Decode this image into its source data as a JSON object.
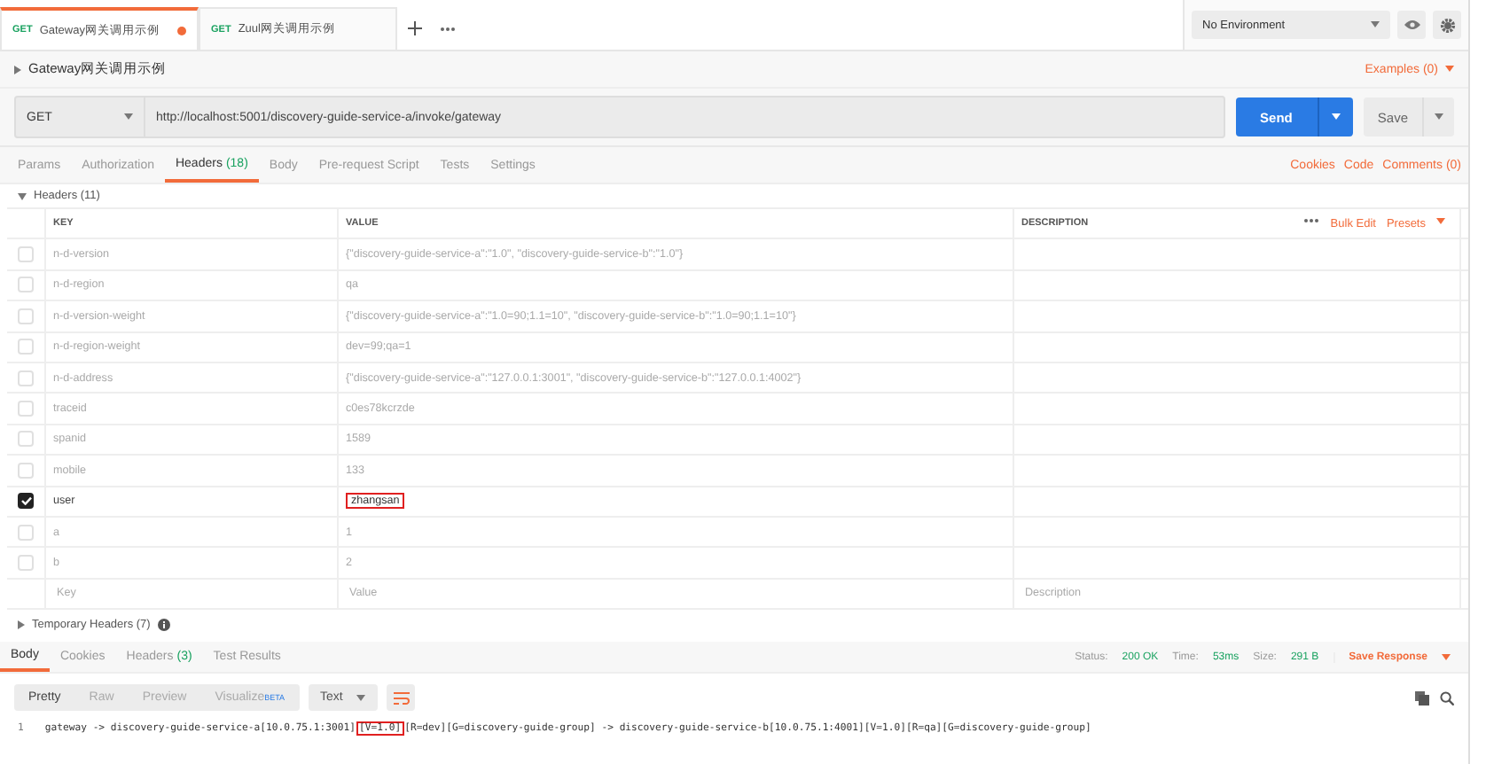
{
  "tabs": [
    {
      "method": "GET",
      "title": "Gateway网关调用示例",
      "selected": true,
      "unsaved": true
    },
    {
      "method": "GET",
      "title": "Zuul网关调用示例",
      "selected": false,
      "unsaved": false
    }
  ],
  "environment": {
    "value": "No Environment"
  },
  "request": {
    "name": "Gateway网关调用示例",
    "examples": "Examples (0)",
    "method": "GET",
    "url": "http://localhost:5001/discovery-guide-service-a/invoke/gateway",
    "send": "Send",
    "save": "Save"
  },
  "request_tabs": [
    {
      "label": "Params",
      "selected": false
    },
    {
      "label": "Authorization",
      "selected": false
    },
    {
      "label": "Headers",
      "count": "(18)",
      "selected": true
    },
    {
      "label": "Body",
      "selected": false
    },
    {
      "label": "Pre-request Script",
      "selected": false
    },
    {
      "label": "Tests",
      "selected": false
    },
    {
      "label": "Settings",
      "selected": false
    }
  ],
  "request_links": [
    "Cookies",
    "Code",
    "Comments (0)"
  ],
  "headers": {
    "title": "Headers (11)",
    "columns": [
      "KEY",
      "VALUE",
      "DESCRIPTION"
    ],
    "bulk_edit": "Bulk Edit",
    "presets": "Presets",
    "rows": [
      {
        "key": "n-d-version",
        "value": "{\"discovery-guide-service-a\":\"1.0\", \"discovery-guide-service-b\":\"1.0\"}",
        "checked": false,
        "highlighted": false
      },
      {
        "key": "n-d-region",
        "value": "qa",
        "checked": false,
        "highlighted": false
      },
      {
        "key": "n-d-version-weight",
        "value": "{\"discovery-guide-service-a\":\"1.0=90;1.1=10\", \"discovery-guide-service-b\":\"1.0=90;1.1=10\"}",
        "checked": false,
        "highlighted": false
      },
      {
        "key": "n-d-region-weight",
        "value": "dev=99;qa=1",
        "checked": false,
        "highlighted": false
      },
      {
        "key": "n-d-address",
        "value": "{\"discovery-guide-service-a\":\"127.0.0.1:3001\", \"discovery-guide-service-b\":\"127.0.0.1:4002\"}",
        "checked": false,
        "highlighted": false
      },
      {
        "key": "traceid",
        "value": "c0es78kcrzde",
        "checked": false,
        "highlighted": false
      },
      {
        "key": "spanid",
        "value": "1589",
        "checked": false,
        "highlighted": false
      },
      {
        "key": "mobile",
        "value": "133",
        "checked": false,
        "highlighted": false
      },
      {
        "key": "user",
        "value": "zhangsan",
        "checked": true,
        "highlighted": true
      },
      {
        "key": "a",
        "value": "1",
        "checked": false,
        "highlighted": false
      },
      {
        "key": "b",
        "value": "2",
        "checked": false,
        "highlighted": false
      }
    ],
    "new_row": {
      "key": {
        "placeholder": "Key"
      },
      "value": {
        "placeholder": "Value"
      },
      "description": {
        "placeholder": "Description"
      }
    }
  },
  "temporary_headers": "Temporary Headers (7)",
  "response_tabs": [
    {
      "label": "Body",
      "selected": true
    },
    {
      "label": "Cookies",
      "selected": false
    },
    {
      "label": "Headers",
      "count": "(3)",
      "selected": false
    },
    {
      "label": "Test Results",
      "selected": false
    }
  ],
  "status": {
    "status_label": "Status:",
    "status": "200 OK",
    "time_label": "Time:",
    "time": "53ms",
    "size_label": "Size:",
    "size": "291 B",
    "save_response": "Save Response"
  },
  "view_modes": [
    {
      "label": "Pretty",
      "selected": true
    },
    {
      "label": "Raw",
      "selected": false
    },
    {
      "label": "Preview",
      "selected": false
    },
    {
      "label": "Visualize",
      "badge": "BETA",
      "selected": false
    }
  ],
  "format": "Text",
  "body": {
    "line_number": "1",
    "segments": [
      {
        "text": "gateway -> discovery-guide-service-a[10.0.75.1:3001]",
        "highlighted": false
      },
      {
        "text": "[V=1.0]",
        "highlighted": true
      },
      {
        "text": "[R=dev][G=discovery-guide-group] -> discovery-guide-service-b[10.0.75.1:4001][V=1.0][R=qa][G=discovery-guide-group]",
        "highlighted": false
      }
    ]
  }
}
